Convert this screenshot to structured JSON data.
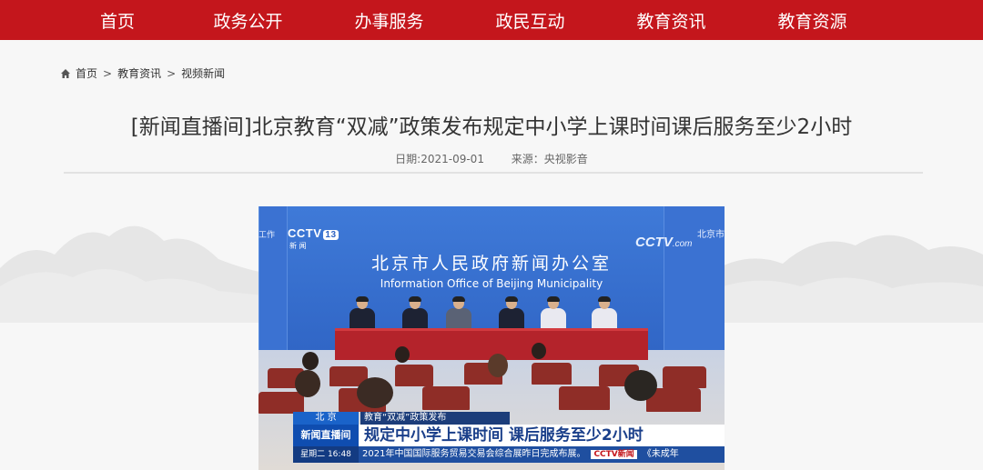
{
  "nav": {
    "items": [
      "首页",
      "政务公开",
      "办事服务",
      "政民互动",
      "教育资讯",
      "教育资源"
    ]
  },
  "breadcrumb": {
    "items": [
      "首页",
      "教育资讯",
      "视频新闻"
    ],
    "separator": ">"
  },
  "article": {
    "title": "[新闻直播间]北京教育“双减”政策发布规定中小学上课时间课后服务至少2小时",
    "date": "日期:2021-09-01",
    "source": "来源：央视影音"
  },
  "video": {
    "channel_logo": "CCTV",
    "channel_number": "13",
    "channel_sub": "新 闻",
    "corner_logo": "CCTV",
    "corner_logo_suffix": ".com",
    "side_left": "工作",
    "side_right": "北京市",
    "office_cn": "北京市人民政府新闻办公室",
    "office_en": "Information Office of Beijing Municipality",
    "lower_third": {
      "place": "北 京",
      "tag": "教育“双减”政策发布",
      "program_logo": "新闻直播间",
      "headline": "规定中小学上课时间 课后服务至少2小时",
      "time": "星期二 16:48",
      "ticker": "2021年中国国际服务贸易交易会综合展昨日完成布展。",
      "ticker_logo": "CCTV新闻",
      "ticker_tail": "《未成年"
    }
  },
  "colors": {
    "nav_bg": "#c4161c",
    "page_bg": "#f7f7f7",
    "title_text": "#333333"
  }
}
